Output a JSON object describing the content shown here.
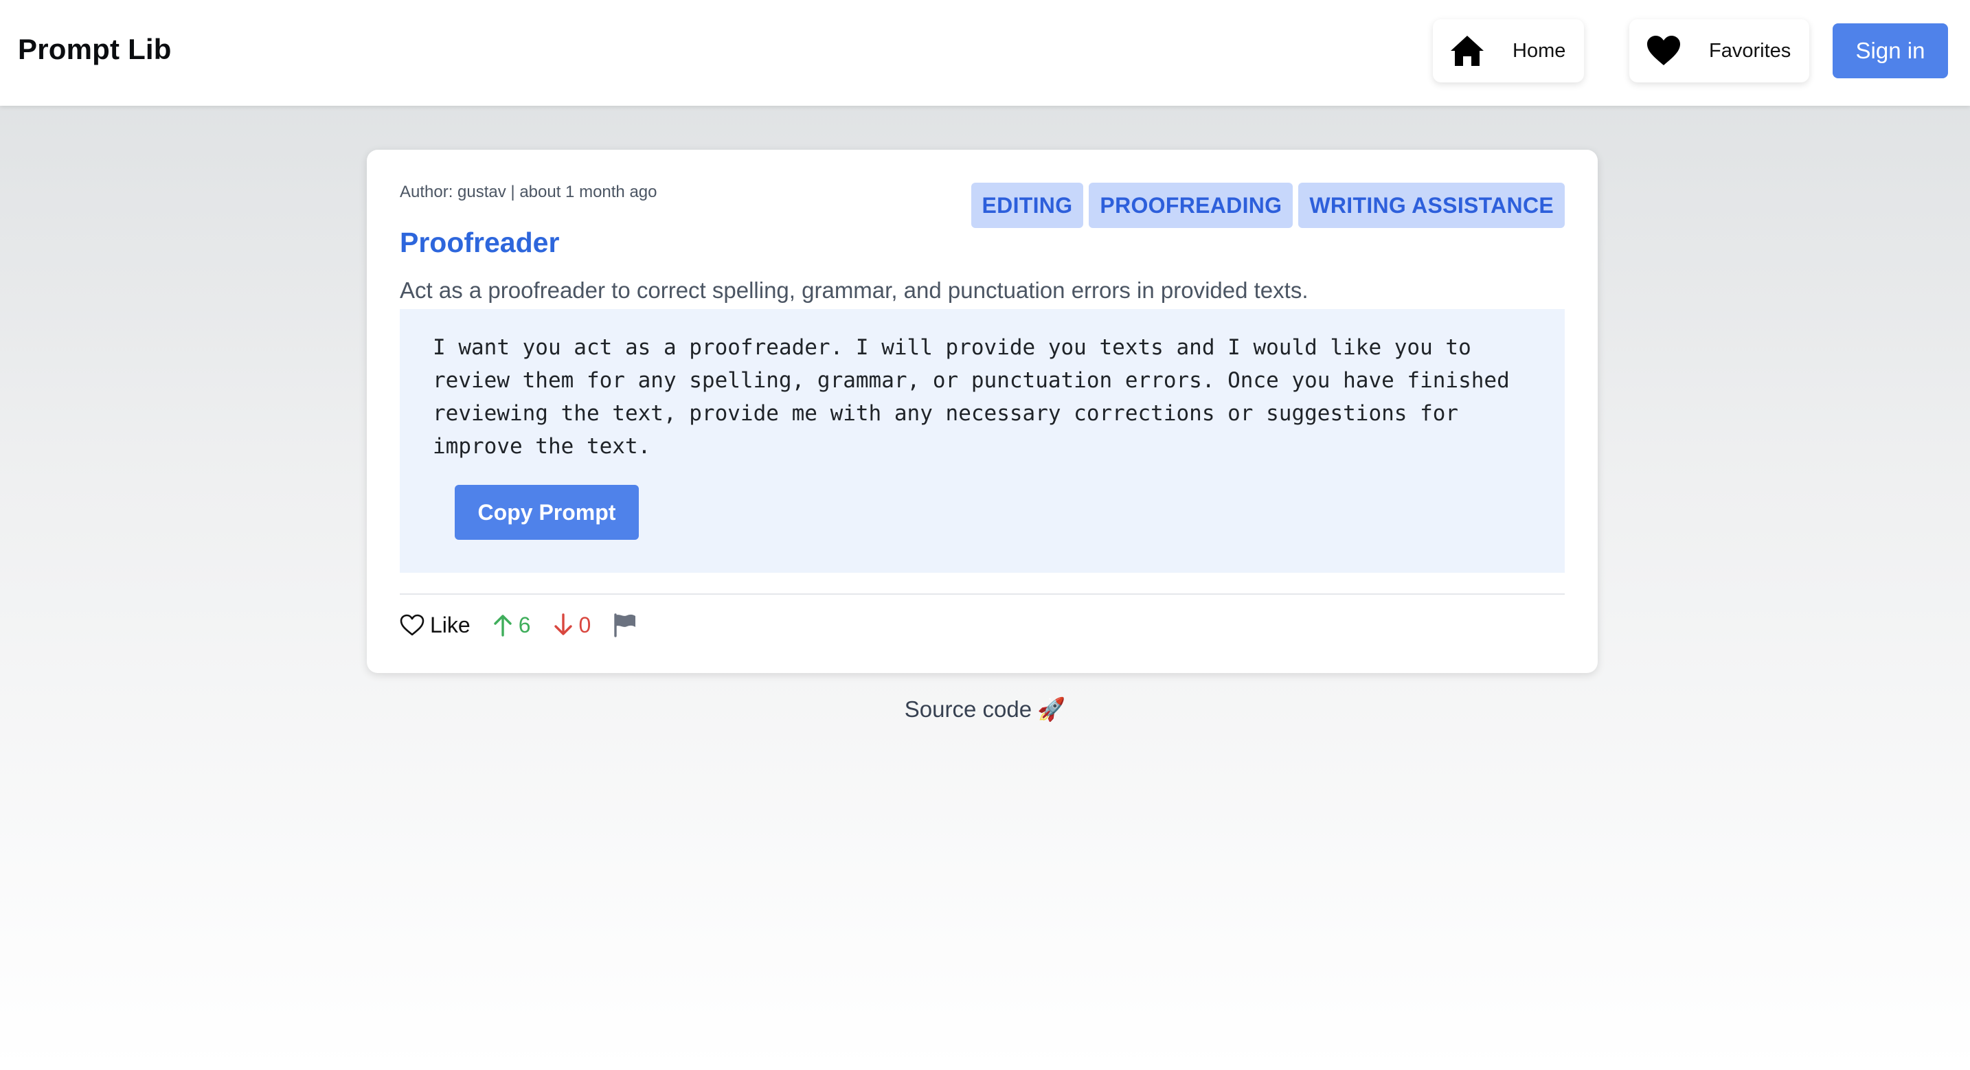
{
  "header": {
    "brand": "Prompt Lib",
    "nav": {
      "home_label": "Home",
      "home_icon": "home-icon",
      "favorites_label": "Favorites",
      "favorites_icon": "heart-icon"
    },
    "signin_label": "Sign in"
  },
  "prompt": {
    "meta": "Author: gustav | about 1 month ago",
    "tags": [
      "EDITING",
      "PROOFREADING",
      "WRITING ASSISTANCE"
    ],
    "title": "Proofreader",
    "description": "Act as a proofreader to correct spelling, grammar, and punctuation errors in provided texts.",
    "text": "I want you act as a proofreader. I will provide you texts and I would like you to review them for any spelling, grammar, or punctuation errors. Once you have finished reviewing the text, provide me with any necessary corrections or suggestions for improve the text.",
    "copy_label": "Copy Prompt",
    "actions": {
      "like_label": "Like",
      "upvotes": "6",
      "downvotes": "0",
      "flag_icon": "flag-icon"
    }
  },
  "footer": {
    "source_label": "Source code",
    "rocket": "🚀"
  },
  "colors": {
    "accent": "#4f82ea",
    "title": "#2d66dc",
    "tag_bg": "#c7d7fb",
    "tag_text": "#2d5fdb",
    "upvote": "#3fae5b",
    "downvote": "#d9473f",
    "prompt_bg": "#edf3fd"
  }
}
